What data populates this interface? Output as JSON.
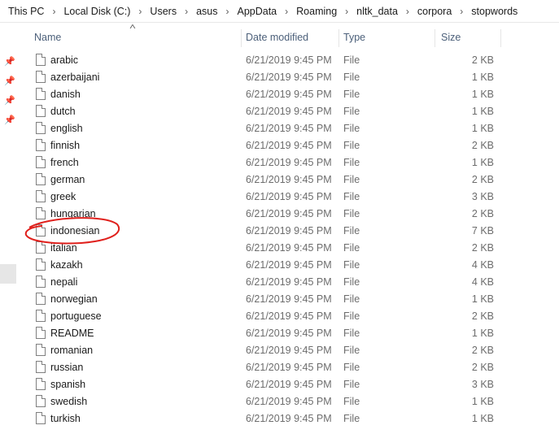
{
  "breadcrumb": [
    "This PC",
    "Local Disk (C:)",
    "Users",
    "asus",
    "AppData",
    "Roaming",
    "nltk_data",
    "corpora",
    "stopwords"
  ],
  "columns": {
    "name": "Name",
    "date": "Date modified",
    "type": "Type",
    "size": "Size"
  },
  "files": [
    {
      "name": "arabic",
      "date": "6/21/2019 9:45 PM",
      "type": "File",
      "size": "2 KB"
    },
    {
      "name": "azerbaijani",
      "date": "6/21/2019 9:45 PM",
      "type": "File",
      "size": "1 KB"
    },
    {
      "name": "danish",
      "date": "6/21/2019 9:45 PM",
      "type": "File",
      "size": "1 KB"
    },
    {
      "name": "dutch",
      "date": "6/21/2019 9:45 PM",
      "type": "File",
      "size": "1 KB"
    },
    {
      "name": "english",
      "date": "6/21/2019 9:45 PM",
      "type": "File",
      "size": "1 KB"
    },
    {
      "name": "finnish",
      "date": "6/21/2019 9:45 PM",
      "type": "File",
      "size": "2 KB"
    },
    {
      "name": "french",
      "date": "6/21/2019 9:45 PM",
      "type": "File",
      "size": "1 KB"
    },
    {
      "name": "german",
      "date": "6/21/2019 9:45 PM",
      "type": "File",
      "size": "2 KB"
    },
    {
      "name": "greek",
      "date": "6/21/2019 9:45 PM",
      "type": "File",
      "size": "3 KB"
    },
    {
      "name": "hungarian",
      "date": "6/21/2019 9:45 PM",
      "type": "File",
      "size": "2 KB"
    },
    {
      "name": "indonesian",
      "date": "6/21/2019 9:45 PM",
      "type": "File",
      "size": "7 KB"
    },
    {
      "name": "italian",
      "date": "6/21/2019 9:45 PM",
      "type": "File",
      "size": "2 KB"
    },
    {
      "name": "kazakh",
      "date": "6/21/2019 9:45 PM",
      "type": "File",
      "size": "4 KB"
    },
    {
      "name": "nepali",
      "date": "6/21/2019 9:45 PM",
      "type": "File",
      "size": "4 KB"
    },
    {
      "name": "norwegian",
      "date": "6/21/2019 9:45 PM",
      "type": "File",
      "size": "1 KB"
    },
    {
      "name": "portuguese",
      "date": "6/21/2019 9:45 PM",
      "type": "File",
      "size": "2 KB"
    },
    {
      "name": "README",
      "date": "6/21/2019 9:45 PM",
      "type": "File",
      "size": "1 KB"
    },
    {
      "name": "romanian",
      "date": "6/21/2019 9:45 PM",
      "type": "File",
      "size": "2 KB"
    },
    {
      "name": "russian",
      "date": "6/21/2019 9:45 PM",
      "type": "File",
      "size": "2 KB"
    },
    {
      "name": "spanish",
      "date": "6/21/2019 9:45 PM",
      "type": "File",
      "size": "3 KB"
    },
    {
      "name": "swedish",
      "date": "6/21/2019 9:45 PM",
      "type": "File",
      "size": "1 KB"
    },
    {
      "name": "turkish",
      "date": "6/21/2019 9:45 PM",
      "type": "File",
      "size": "1 KB"
    }
  ],
  "icons": {
    "quick_access": "pin-icon",
    "file": "file-icon",
    "sort": "sort-up-icon"
  },
  "colors": {
    "header_text": "#4c607a",
    "detail_text": "#6d6d6d",
    "annotation": "#e0201c"
  }
}
